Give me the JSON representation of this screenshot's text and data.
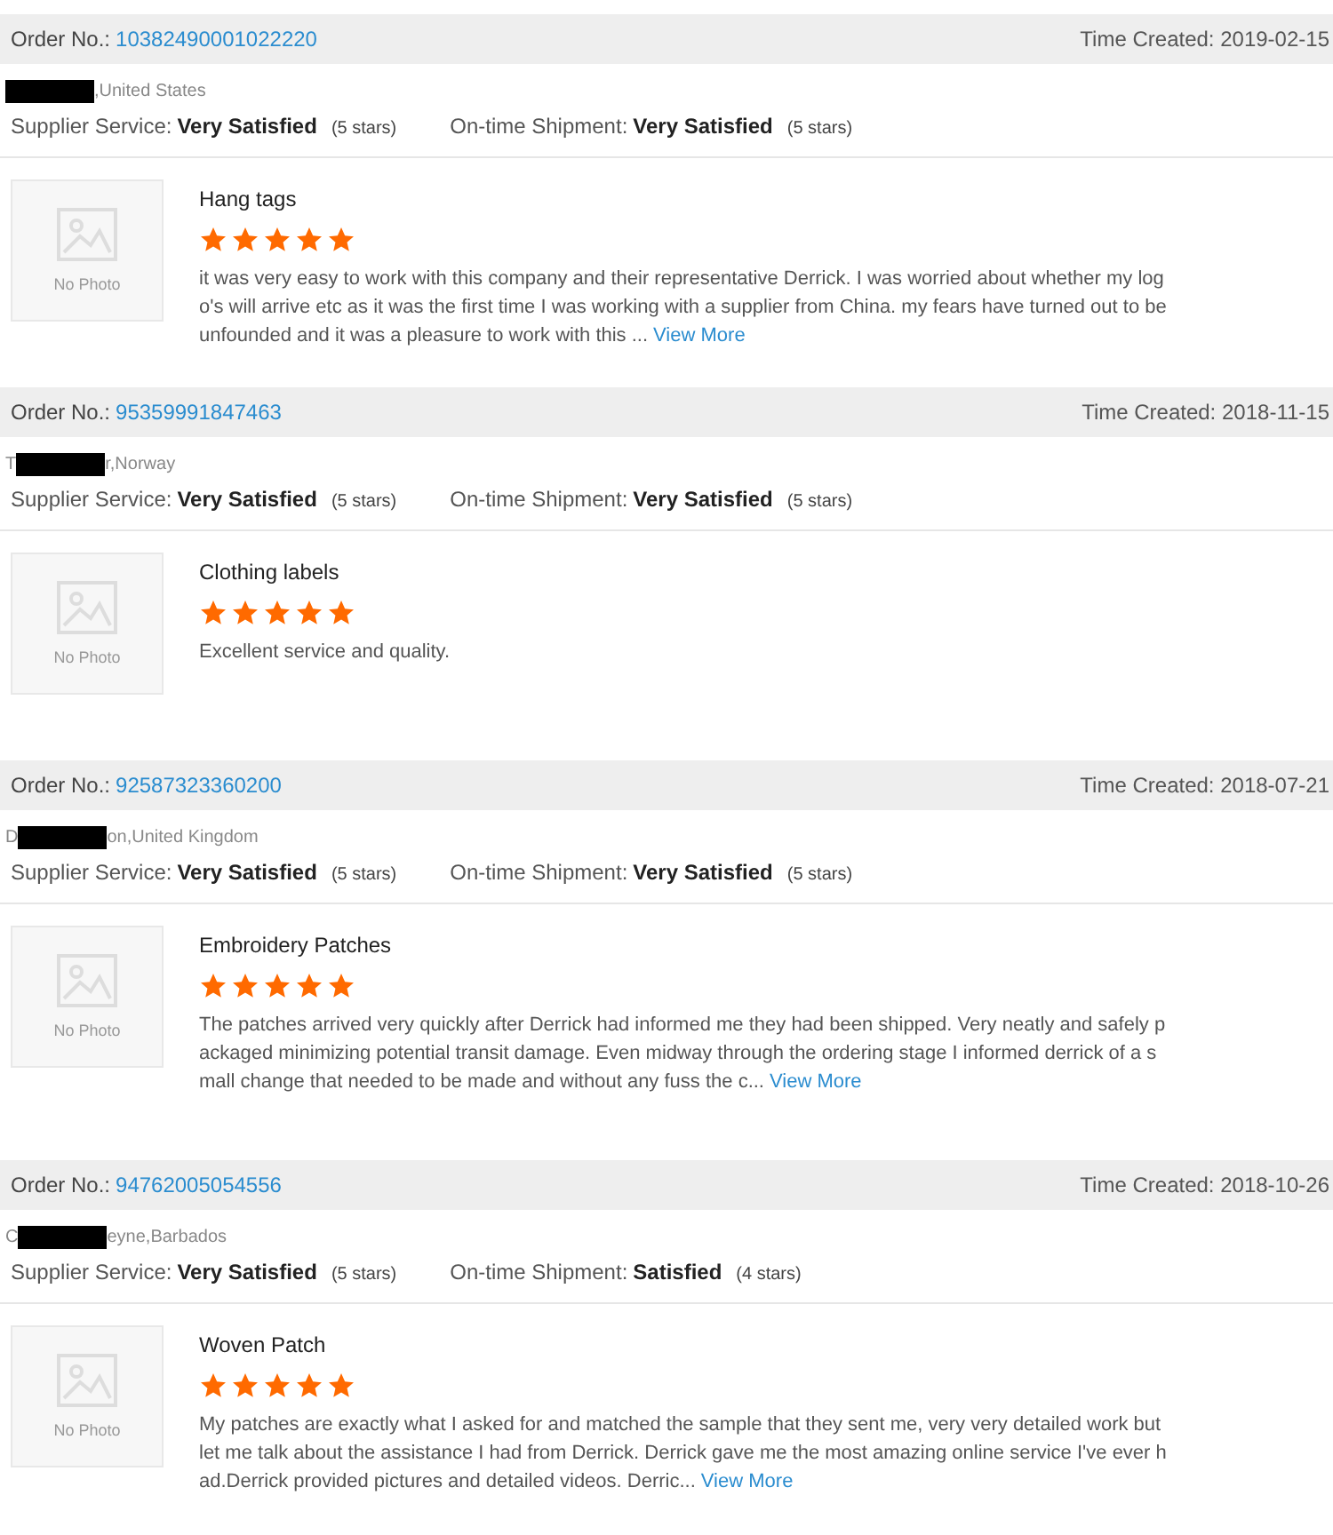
{
  "orders": [
    {
      "order_label": "Order No.:",
      "order_no": "10382490001022220",
      "time_label": "Time Created:",
      "time": "2019-02-15",
      "location_suffix": ",United States",
      "ratings": [
        {
          "label": "Supplier Service:",
          "value": "Very Satisfied",
          "count": "(5 stars)"
        },
        {
          "label": "On-time Shipment:",
          "value": "Very Satisfied",
          "count": "(5 stars)"
        }
      ],
      "product": "Hang tags",
      "photo_text": "No Photo",
      "stars": 5,
      "review": "it was very easy to work with this company and their representative Derrick. I was worried about whether my logo's will arrive etc as it was the first time I was working with a supplier from China. my fears have turned out to be unfounded and it was a pleasure to work with this ...",
      "more": "View More"
    },
    {
      "order_label": "Order No.:",
      "order_no": "95359991847463",
      "time_label": "Time Created:",
      "time": "2018-11-15",
      "location_prefix": "T",
      "location_suffix": "r,Norway",
      "ratings": [
        {
          "label": "Supplier Service:",
          "value": "Very Satisfied",
          "count": "(5 stars)"
        },
        {
          "label": "On-time Shipment:",
          "value": "Very Satisfied",
          "count": "(5 stars)"
        }
      ],
      "product": "Clothing labels",
      "photo_text": "No Photo",
      "stars": 5,
      "review": "Excellent service and quality."
    },
    {
      "order_label": "Order No.:",
      "order_no": "92587323360200",
      "time_label": "Time Created:",
      "time": "2018-07-21",
      "location_prefix": "D",
      "location_suffix": "on,United Kingdom",
      "ratings": [
        {
          "label": "Supplier Service:",
          "value": "Very Satisfied",
          "count": "(5 stars)"
        },
        {
          "label": "On-time Shipment:",
          "value": "Very Satisfied",
          "count": "(5 stars)"
        }
      ],
      "product": "Embroidery Patches",
      "photo_text": "No Photo",
      "stars": 5,
      "review": "The patches arrived very quickly after Derrick had informed me they had been shipped. Very neatly and safely packaged minimizing potential transit damage. Even midway through the ordering stage I informed derrick of a small change that needed to be made and without any fuss the c...",
      "more": "View More"
    },
    {
      "order_label": "Order No.:",
      "order_no": "94762005054556",
      "time_label": "Time Created:",
      "time": "2018-10-26",
      "location_prefix": "C",
      "location_suffix": "eyne,Barbados",
      "ratings": [
        {
          "label": "Supplier Service:",
          "value": "Very Satisfied",
          "count": "(5 stars)"
        },
        {
          "label": "On-time Shipment:",
          "value": "Satisfied",
          "count": "(4 stars)"
        }
      ],
      "product": "Woven Patch",
      "photo_text": "No Photo",
      "stars": 5,
      "review": "My patches are exactly what I asked for and matched the sample that they sent me, very very detailed work but let me talk about the assistance I had from Derrick.  Derrick gave me the most amazing online service I've ever had.Derrick provided pictures and detailed videos. Derric...",
      "more": "View More"
    }
  ]
}
